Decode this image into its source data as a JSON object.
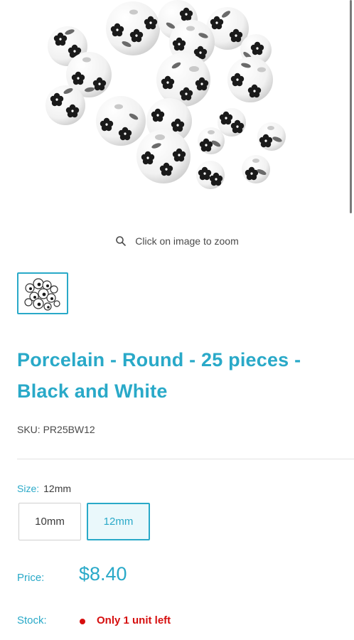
{
  "product": {
    "zoom_hint": "Click on image to zoom",
    "title": "Porcelain - Round - 25 pieces - Black and White",
    "sku_label": "SKU:",
    "sku_value": "PR25BW12",
    "size_label": "Size:",
    "size_value": "12mm",
    "size_options": [
      "10mm",
      "12mm"
    ],
    "selected_size": "12mm",
    "price_label": "Price:",
    "price": "$8.40",
    "stock_label": "Stock:",
    "stock_text": "Only 1 unit left"
  },
  "colors": {
    "accent": "#29a9c8",
    "stock_warning": "#d60f0f"
  },
  "icons": {
    "zoom": "magnifier-icon",
    "stock_dot": "status-dot-icon"
  }
}
